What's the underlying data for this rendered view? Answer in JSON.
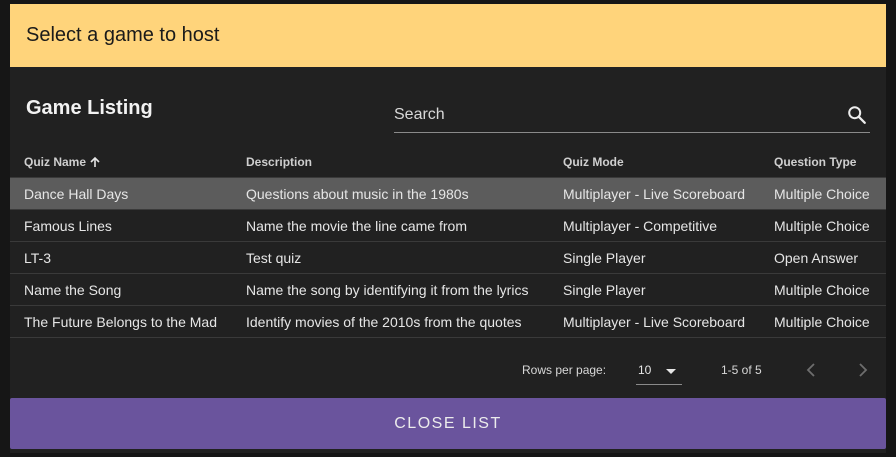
{
  "dialog": {
    "title": "Select a game to host"
  },
  "listing": {
    "title": "Game Listing",
    "search_placeholder": "Search"
  },
  "table": {
    "headers": [
      "Quiz Name",
      "Description",
      "Quiz Mode",
      "Question Type"
    ],
    "sorted_column": "Quiz Name",
    "sort_direction": "ascending",
    "rows": [
      [
        "Dance Hall Days",
        "Questions about music in the 1980s",
        "Multiplayer - Live Scoreboard",
        "Multiple Choice"
      ],
      [
        "Famous Lines",
        "Name the movie the line came from",
        "Multiplayer - Competitive",
        "Multiple Choice"
      ],
      [
        "LT-3",
        "Test quiz",
        "Single Player",
        "Open Answer"
      ],
      [
        "Name the Song",
        "Name the song by identifying it from the lyrics",
        "Single Player",
        "Multiple Choice"
      ],
      [
        "The Future Belongs to the Mad",
        "Identify movies of the 2010s from the quotes",
        "Multiplayer - Live Scoreboard",
        "Multiple Choice"
      ]
    ],
    "selected_row": 0
  },
  "pagination": {
    "rows_per_page_label": "Rows per page:",
    "rows_per_page": "10",
    "range": "1-5 of 5"
  },
  "footer": {
    "close_label": "CLOSE LIST"
  },
  "colors": {
    "header_bg": "#ffd47b",
    "button_bg": "#6a549d",
    "selected_row_bg": "#5c5c5c"
  }
}
